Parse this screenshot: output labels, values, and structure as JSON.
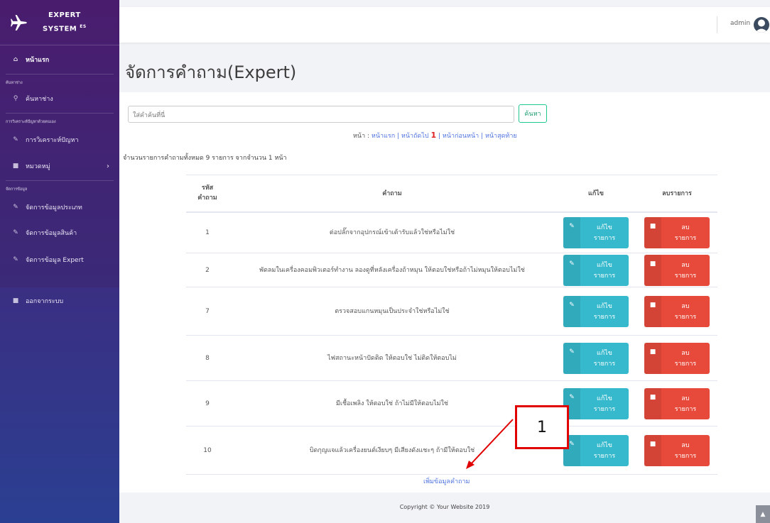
{
  "brand": {
    "line1": "EXPERT",
    "line2": "SYSTEM",
    "sup": "ES"
  },
  "sidebar": {
    "home": "หน้าแรก",
    "head_search": "ค้นหาช่าง",
    "search_tech": "ค้นหาช่าง",
    "head_diag": "การวิเคราะห์ปัญหาด้วยตนเอง",
    "diagnose": "การวิเคราะห์ปัญหา",
    "category": "หมวดหมู่",
    "head_manage": "จัดการข้อมูล",
    "manage_type": "จัดการข้อมูลประเภท",
    "manage_product": "จัดการข้อมูลสินค้า",
    "manage_expert": "จัดการข้อมูล Expert",
    "logout": "ออกจากระบบ"
  },
  "topbar": {
    "user": "admin"
  },
  "page": {
    "title": "จัดการคำถาม(Expert)"
  },
  "search": {
    "placeholder": "ใส่คำค้นที่นี่",
    "button": "ค้นหา"
  },
  "pager": {
    "label": "หน้า :",
    "first": "หน้าแรก",
    "next": "หน้าถัดไป",
    "current": "1",
    "prev": "หน้าก่อนหน้า",
    "last": "หน้าสุดท้าย"
  },
  "summary": "จำนวนรายการคำถามทั้งหมด 9 รายการ จากจำนวน 1 หน้า",
  "table": {
    "headers": {
      "id_line1": "รหัส",
      "id_line2": "คำถาม",
      "question": "คำถาม",
      "edit": "แก้ไข",
      "delete": "ลบรายการ"
    },
    "edit_label_1": "แก้ไข",
    "edit_label_2": "รายการ",
    "delete_label_1": "ลบ",
    "delete_label_2": "รายการ",
    "rows": [
      {
        "id": "1",
        "question": "ต่อปลั๊กจากอุปกรณ์เข้าเต้ารับแล้วใช่หรือไม่ใช่"
      },
      {
        "id": "2",
        "question": "พัดลมในเครื่องคอมพิวเตอร์ทำงาน ลองดูที่หลังเครื่องถ้าหมุน ให้ตอบใช่หรือถ้าไม่หมุนให้ตอบไม่ใช่"
      },
      {
        "id": "7",
        "question": "ตรวจสอบแกนหมุนเป็นประจำใช่หรือไม่ใช่"
      },
      {
        "id": "8",
        "question": "ไฟสถานะหน้าปัดติด ให้ตอบใช่ ไม่ติดให้ตอบไม่"
      },
      {
        "id": "9",
        "question": "มีเชื้อเพลิง ให้ตอบใช่ ถ้าไม่มีให้ตอบไม่ใช่"
      },
      {
        "id": "10",
        "question": "บิดกุญแจแล้วเครื่องยนต์เงียบๆ มีเสียงดังแชะๆ ถ้ามีให้ตอบใช่"
      }
    ]
  },
  "add_link": "เพิ่มข้อมูลคำถาม",
  "footer": "Copyright © Your Website 2019",
  "annotation": {
    "label": "1",
    "color": "#e00000"
  }
}
